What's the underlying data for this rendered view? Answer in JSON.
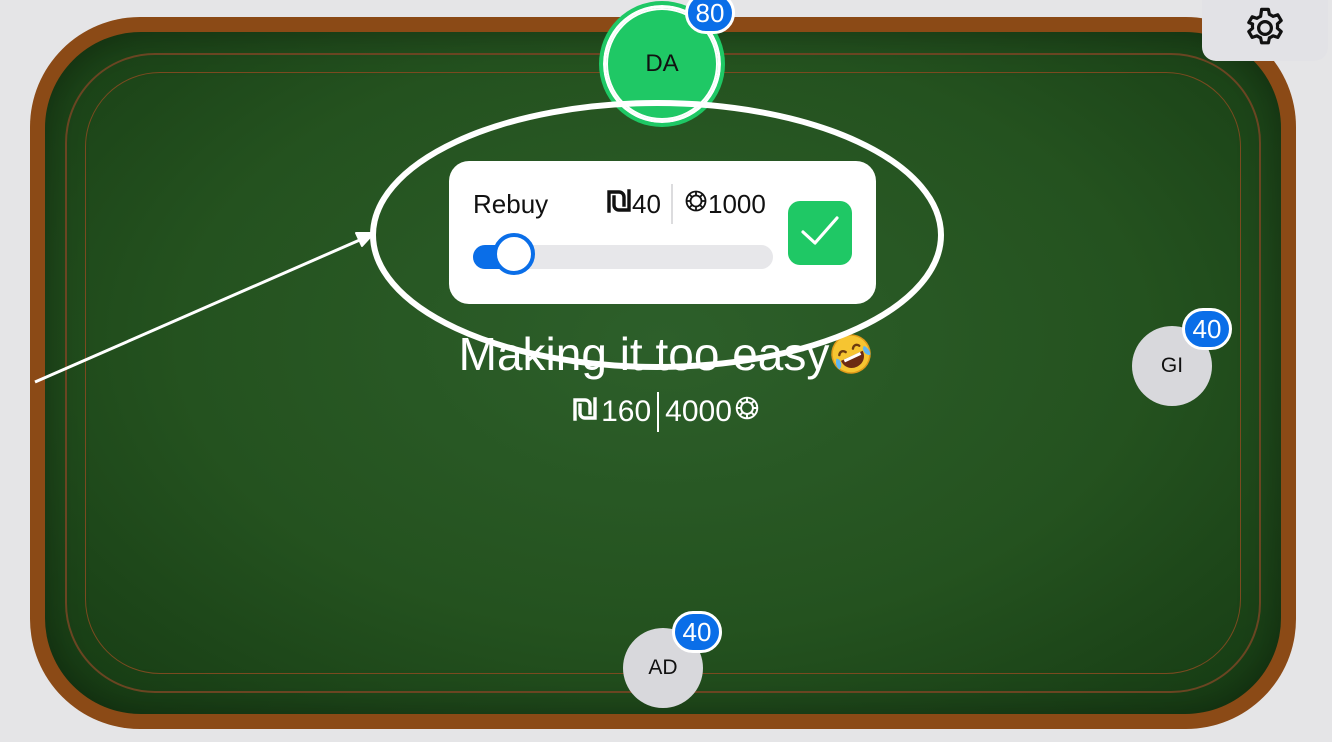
{
  "seats": {
    "top": {
      "initials": "DA",
      "stack": "80",
      "active": true
    },
    "right": {
      "initials": "GI",
      "stack": "40"
    },
    "bottom": {
      "initials": "AD",
      "stack": "40"
    }
  },
  "rebuy": {
    "label": "Rebuy",
    "amount": "40",
    "currency_icon": "shekel-icon",
    "chips": "1000",
    "chip_icon": "chip-icon",
    "slider_fraction": 0.04,
    "confirm_icon": "checkmark-icon"
  },
  "table": {
    "name": "Making it too easy",
    "name_emoji": "rofl-emoji",
    "pot_amount": "160",
    "pot_chips": "4000"
  },
  "toolbar": {
    "settings_icon": "gear-icon"
  },
  "colors": {
    "felt": "#24521f",
    "rim": "#8b4a16",
    "active_seat": "#1fc865",
    "badge": "#0a6ee8",
    "confirm": "#1fc865",
    "annotation": "#ffffff"
  },
  "annotation": {
    "shapes": [
      "ellipse-highlight",
      "arrow"
    ]
  }
}
